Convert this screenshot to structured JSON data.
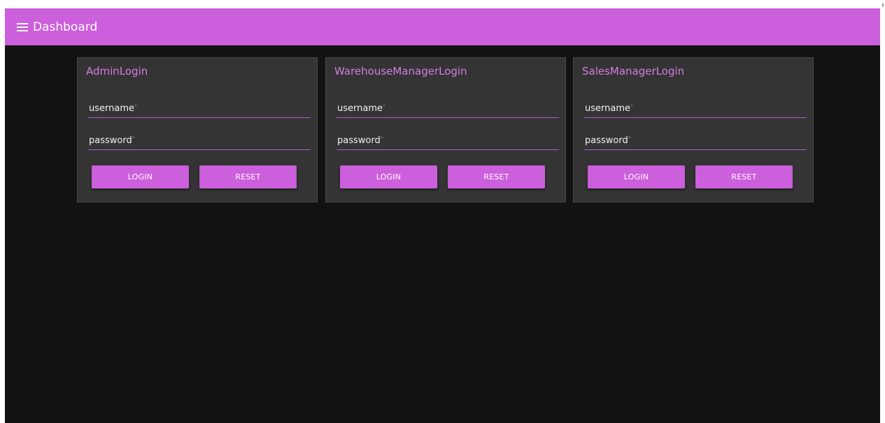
{
  "toolbar": {
    "title": "Dashboard",
    "menu_icon": "hamburger-menu-icon"
  },
  "cards": [
    {
      "title": "AdminLogin",
      "username_label": "username",
      "password_label": "password",
      "required_mark": "*",
      "login_label": "LOGIN",
      "reset_label": "RESET"
    },
    {
      "title": "WarehouseManagerLogin",
      "username_label": "username",
      "password_label": "password",
      "required_mark": "*",
      "login_label": "LOGIN",
      "reset_label": "RESET"
    },
    {
      "title": "SalesManagerLogin",
      "username_label": "username",
      "password_label": "password",
      "required_mark": "*",
      "login_label": "LOGIN",
      "reset_label": "RESET"
    }
  ],
  "colors": {
    "accent": "#cc5fdc",
    "background": "#121212",
    "card": "#343434",
    "title_text": "#d47ee2"
  }
}
